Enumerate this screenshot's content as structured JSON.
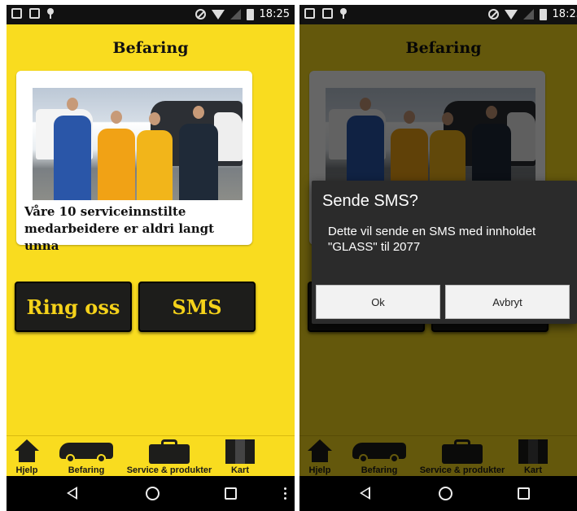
{
  "status_bar": {
    "time": "18:25"
  },
  "app": {
    "title": "Befaring",
    "card_caption": "Våre 10 serviceinnstilte medarbeidere er aldri langt unna",
    "ring_button": "Ring oss",
    "sms_button": "SMS",
    "colors": {
      "background": "#f9dc1f",
      "button": "#1d1d1b",
      "button_text": "#f5d21a"
    }
  },
  "bottom_tabs": [
    {
      "label": "Hjelp",
      "icon": "home-icon"
    },
    {
      "label": "Befaring",
      "icon": "van-icon"
    },
    {
      "label": "Service & produkter",
      "icon": "toolbox-icon"
    },
    {
      "label": "Kart",
      "icon": "map-icon"
    }
  ],
  "dialog": {
    "title": "Sende SMS?",
    "message": "Dette vil sende en SMS med innholdet \"GLASS\" til 2077",
    "ok": "Ok",
    "cancel": "Avbryt"
  }
}
